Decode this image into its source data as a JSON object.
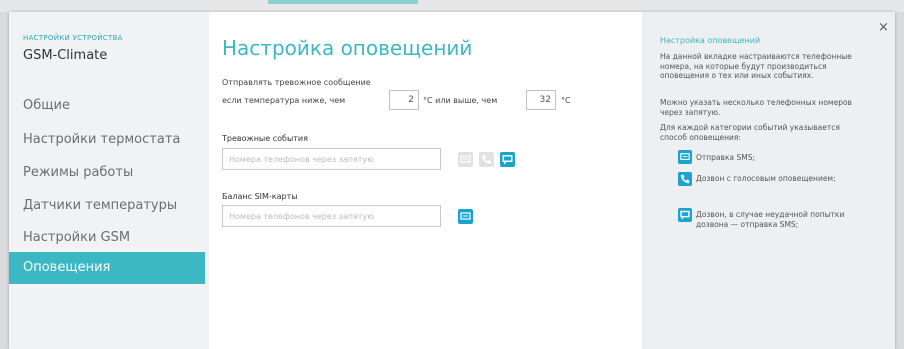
{
  "sidebar": {
    "kicker": "НАСТРОЙКИ УСТРОЙСТВА",
    "device_name": "GSM-Climate",
    "items": [
      {
        "label": "Общие"
      },
      {
        "label": "Настройки термостата"
      },
      {
        "label": "Режимы работы"
      },
      {
        "label": "Датчики температуры"
      },
      {
        "label": "Настройки GSM"
      },
      {
        "label": "Оповещения",
        "active": true
      }
    ]
  },
  "main": {
    "title": "Настройка оповещений",
    "alarm_line1": "Отправлять тревожное сообщение",
    "alarm_prefix": "если температура ниже, чем",
    "low_value": "2",
    "mid_text": "°C или выше, чем",
    "high_value": "32",
    "unit": "°C",
    "events": {
      "title": "Тревожные события",
      "placeholder": "Номера телефонов через запятую"
    },
    "balance": {
      "title": "Баланс SIM-карты",
      "placeholder": "Номера телефонов через запятую"
    }
  },
  "help": {
    "title": "Настройка оповещений",
    "p1": "На данной вкладке настраиваются телефонные номера, на которые будут производиться оповещения о тех или иных событиях.",
    "p2": "Можно указать несколько телефонных номеров через запятую.",
    "p3": "Для каждой категории событий указывается способ оповещения:",
    "items": [
      {
        "icon": "sms-icon",
        "text": "Отправка SMS;"
      },
      {
        "icon": "phone-call-icon",
        "text": "Дозвон с голосовым оповещением;"
      },
      {
        "icon": "call-then-sms-icon",
        "text": "Дозвон, в случае неудачной попытки дозвона — отправка SMS;"
      }
    ],
    "close_symbol": "×"
  },
  "colors": {
    "accent": "#3bb8c3",
    "icon_active": "#1aa3cc",
    "icon_inactive": "#dfe1e2"
  }
}
